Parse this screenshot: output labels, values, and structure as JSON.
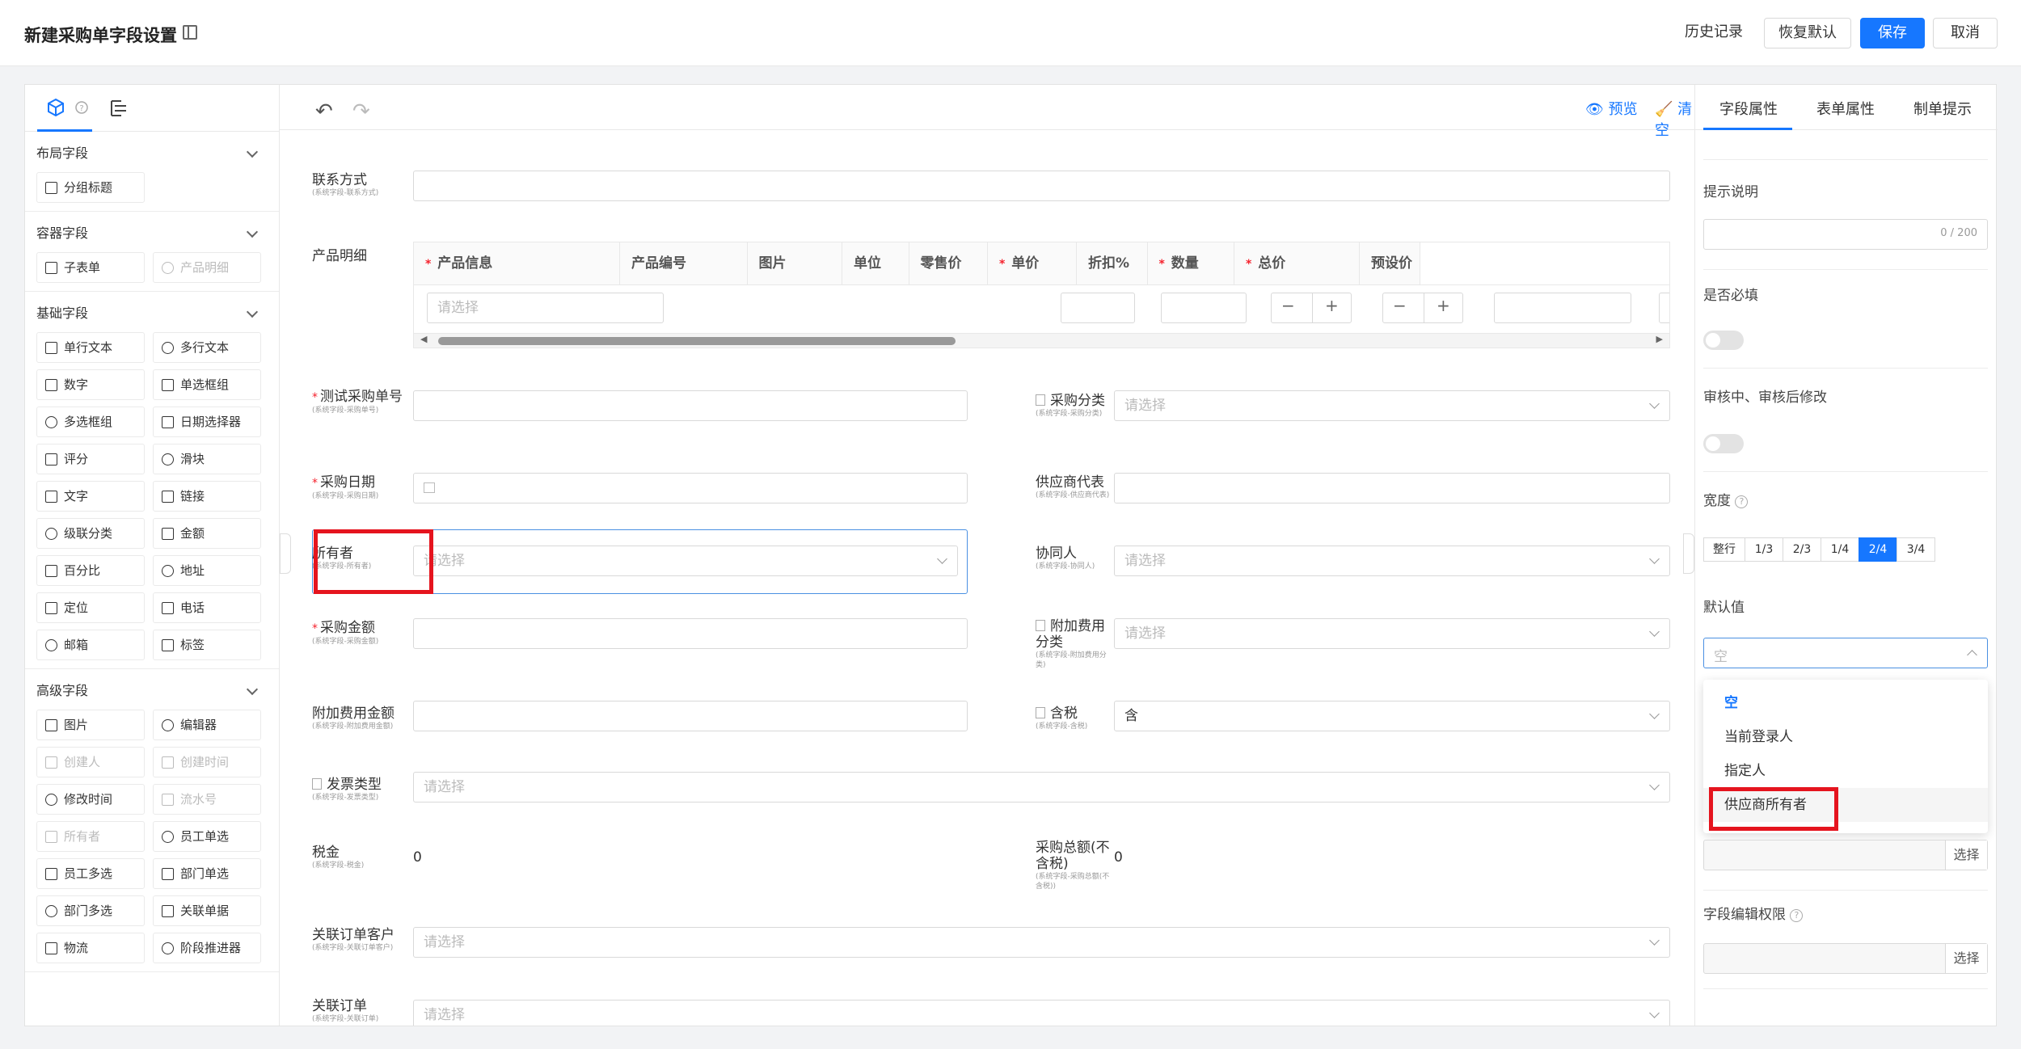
{
  "header": {
    "title": "新建采购单字段设置",
    "history": "历史记录",
    "restore": "恢复默认",
    "save": "保存",
    "cancel": "取消"
  },
  "left": {
    "groups": [
      {
        "title": "布局字段",
        "items": [
          {
            "label": "分组标题",
            "disabled": false
          }
        ]
      },
      {
        "title": "容器字段",
        "items": [
          {
            "label": "子表单",
            "disabled": false
          },
          {
            "label": "产品明细",
            "disabled": true
          }
        ]
      },
      {
        "title": "基础字段",
        "items": [
          {
            "label": "单行文本",
            "disabled": false
          },
          {
            "label": "多行文本",
            "disabled": false
          },
          {
            "label": "数字",
            "disabled": false
          },
          {
            "label": "单选框组",
            "disabled": false
          },
          {
            "label": "多选框组",
            "disabled": false
          },
          {
            "label": "日期选择器",
            "disabled": false
          },
          {
            "label": "评分",
            "disabled": false
          },
          {
            "label": "滑块",
            "disabled": false
          },
          {
            "label": "文字",
            "disabled": false
          },
          {
            "label": "链接",
            "disabled": false
          },
          {
            "label": "级联分类",
            "disabled": false
          },
          {
            "label": "金额",
            "disabled": false
          },
          {
            "label": "百分比",
            "disabled": false
          },
          {
            "label": "地址",
            "disabled": false
          },
          {
            "label": "定位",
            "disabled": false
          },
          {
            "label": "电话",
            "disabled": false
          },
          {
            "label": "邮箱",
            "disabled": false
          },
          {
            "label": "标签",
            "disabled": false
          }
        ]
      },
      {
        "title": "高级字段",
        "items": [
          {
            "label": "图片",
            "disabled": false
          },
          {
            "label": "编辑器",
            "disabled": false
          },
          {
            "label": "创建人",
            "disabled": true
          },
          {
            "label": "创建时间",
            "disabled": true
          },
          {
            "label": "修改时间",
            "disabled": false
          },
          {
            "label": "流水号",
            "disabled": true
          },
          {
            "label": "所有者",
            "disabled": true
          },
          {
            "label": "员工单选",
            "disabled": false
          },
          {
            "label": "员工多选",
            "disabled": false
          },
          {
            "label": "部门单选",
            "disabled": false
          },
          {
            "label": "部门多选",
            "disabled": false
          },
          {
            "label": "关联单据",
            "disabled": false
          },
          {
            "label": "物流",
            "disabled": false
          },
          {
            "label": "阶段推进器",
            "disabled": false
          }
        ]
      }
    ]
  },
  "toolbar": {
    "preview": "预览",
    "clear": "清空"
  },
  "form": {
    "contact": {
      "label": "联系方式",
      "sub": "(系统字段-联系方式)"
    },
    "product": {
      "label": "产品明细",
      "columns": [
        "产品信息",
        "产品编号",
        "图片",
        "单位",
        "零售价",
        "单价",
        "折扣%",
        "数量",
        "总价",
        "预设价"
      ],
      "required": [
        true,
        false,
        false,
        false,
        false,
        true,
        false,
        true,
        true,
        false
      ],
      "select_placeholder": "请选择"
    },
    "order_no": {
      "label": "测试采购单号",
      "sub": "(系统字段-采购单号)"
    },
    "category": {
      "label": "采购分类",
      "sub": "(系统字段-采购分类)",
      "placeholder": "请选择"
    },
    "date": {
      "label": "采购日期",
      "sub": "(系统字段-采购日期)"
    },
    "supplier_rep": {
      "label": "供应商代表",
      "sub": "(系统字段-供应商代表)"
    },
    "owner": {
      "label": "所有者",
      "sub": "(系统字段-所有者)",
      "placeholder": "请选择"
    },
    "collaborator": {
      "label": "协同人",
      "sub": "(系统字段-协同人)",
      "placeholder": "请选择"
    },
    "amount": {
      "label": "采购金额",
      "sub": "(系统字段-采购金额)"
    },
    "extra_cat": {
      "label": "附加费用分类",
      "sub": "(系统字段-附加费用分类)",
      "placeholder": "请选择"
    },
    "extra_amount": {
      "label": "附加费用金额",
      "sub": "(系统字段-附加费用金额)"
    },
    "tax_inc": {
      "label": "含税",
      "sub": "(系统字段-含税)",
      "value": "含"
    },
    "invoice": {
      "label": "发票类型",
      "sub": "(系统字段-发票类型)",
      "placeholder": "请选择"
    },
    "tax": {
      "label": "税金",
      "sub": "(系统字段-税金)",
      "value": "0"
    },
    "total_ex": {
      "label": "采购总额(不含税)",
      "sub": "(系统字段-采购总额(不含税))",
      "value": "0"
    },
    "order_customer": {
      "label": "关联订单客户",
      "sub": "(系统字段-关联订单客户)",
      "placeholder": "请选择"
    },
    "order": {
      "label": "关联订单",
      "sub": "(系统字段-关联订单)",
      "placeholder": "请选择"
    }
  },
  "right": {
    "tabs": [
      "字段属性",
      "表单属性",
      "制单提示"
    ],
    "hint_label": "提示说明",
    "hint_count": "0 / 200",
    "required_label": "是否必填",
    "audit_label": "审核中、审核后修改",
    "width_label": "宽度",
    "widths": [
      "整行",
      "1/3",
      "2/3",
      "1/4",
      "2/4",
      "3/4"
    ],
    "active_width": "2/4",
    "default_label": "默认值",
    "default_value": "空",
    "options": [
      "空",
      "当前登录人",
      "指定人",
      "供应商所有者"
    ],
    "select_btn": "选择",
    "edit_perm_label": "字段编辑权限"
  },
  "colors": {
    "primary": "#1677ff",
    "highlight": "#e5141e"
  }
}
